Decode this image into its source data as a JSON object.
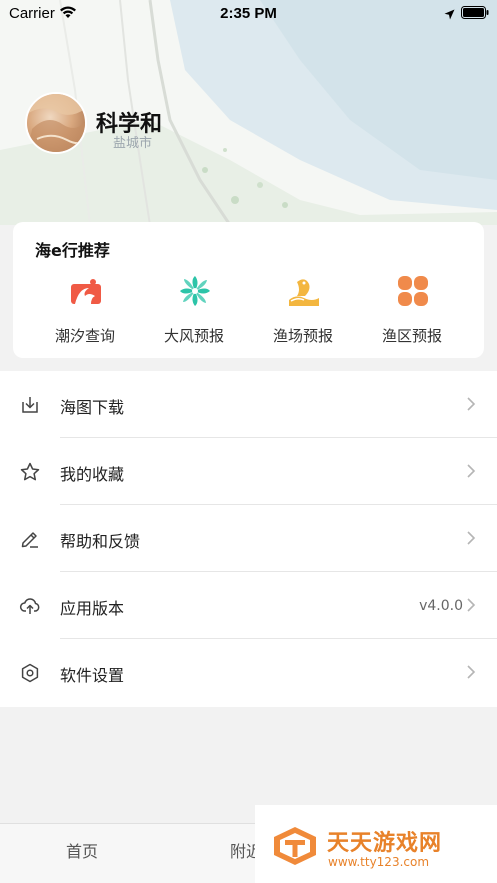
{
  "status_bar": {
    "carrier": "Carrier",
    "time": "2:35 PM"
  },
  "profile": {
    "username": "科学和",
    "map_label": "盐城市"
  },
  "recommend": {
    "title": "海e行推荐",
    "items": [
      {
        "label": "潮汐查询",
        "icon": "tide-icon",
        "color": "#f05a45"
      },
      {
        "label": "大风预报",
        "icon": "wind-icon",
        "color": "#2cc4a8"
      },
      {
        "label": "渔场预报",
        "icon": "fishery-icon",
        "color": "#f3b63f"
      },
      {
        "label": "渔区预报",
        "icon": "fishing-zone-icon",
        "color": "#f08a4b"
      }
    ]
  },
  "menu": {
    "items": [
      {
        "label": "海图下载",
        "icon": "download-icon",
        "value": ""
      },
      {
        "label": "我的收藏",
        "icon": "star-icon",
        "value": ""
      },
      {
        "label": "帮助和反馈",
        "icon": "pencil-icon",
        "value": ""
      },
      {
        "label": "应用版本",
        "icon": "cloud-upload-icon",
        "value": "v4.0.0"
      },
      {
        "label": "软件设置",
        "icon": "settings-icon",
        "value": ""
      }
    ]
  },
  "tab_bar": {
    "tabs": [
      {
        "label": "首页"
      },
      {
        "label": "附近"
      }
    ]
  },
  "watermark": {
    "title": "天天游戏网",
    "url": "www.tty123.com"
  }
}
